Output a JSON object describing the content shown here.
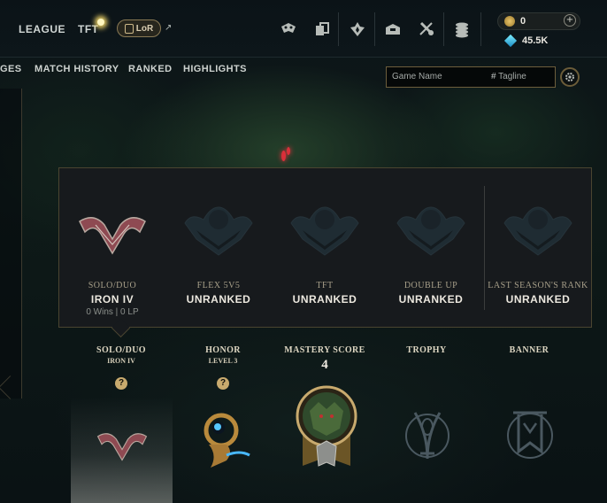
{
  "top_nav": {
    "tabs": [
      "LEAGUE",
      "TFT"
    ],
    "lor_label": "LoR",
    "external_link_glyph": "↗"
  },
  "toolbar_icons": [
    "store-icon",
    "collection-icon",
    "loot-icon",
    "inventory-icon",
    "crafting-icon",
    "currency-icon"
  ],
  "wallet": {
    "rp": "0",
    "blue_essence": "45.5K",
    "add_label": "+"
  },
  "sub_nav": {
    "tabs": [
      "GES",
      "MATCH HISTORY",
      "RANKED",
      "HIGHLIGHTS"
    ]
  },
  "search": {
    "name_placeholder": "Game Name",
    "tag_prefix": "#",
    "tag_placeholder": "Tagline"
  },
  "ranks_popup": {
    "queues": [
      {
        "name": "SOLO/DUO",
        "rank": "IRON IV",
        "stats": "0 Wins | 0 LP",
        "emblem": "iron-emblem"
      },
      {
        "name": "FLEX 5V5",
        "rank": "UNRANKED",
        "stats": "",
        "emblem": "unranked-emblem"
      },
      {
        "name": "TFT",
        "rank": "UNRANKED",
        "stats": "",
        "emblem": "unranked-emblem"
      },
      {
        "name": "DOUBLE UP",
        "rank": "UNRANKED",
        "stats": "",
        "emblem": "unranked-emblem"
      },
      {
        "name": "LAST SEASON'S RANK",
        "rank": "UNRANKED",
        "stats": "",
        "emblem": "unranked-emblem"
      }
    ]
  },
  "profile_cards": {
    "solo": {
      "title": "SOLO/DUO",
      "sub": "IRON IV",
      "help": "?"
    },
    "honor": {
      "title": "HONOR",
      "sub": "LEVEL 3",
      "help": "?"
    },
    "mastery": {
      "title": "MASTERY SCORE",
      "value": "4"
    },
    "trophy": {
      "title": "TROPHY"
    },
    "banner": {
      "title": "BANNER"
    }
  },
  "colors": {
    "gold": "#c8aa6e",
    "popup_bg": "#171a1d",
    "iron": "#8e4a52",
    "unranked": "#1f4a5c"
  }
}
